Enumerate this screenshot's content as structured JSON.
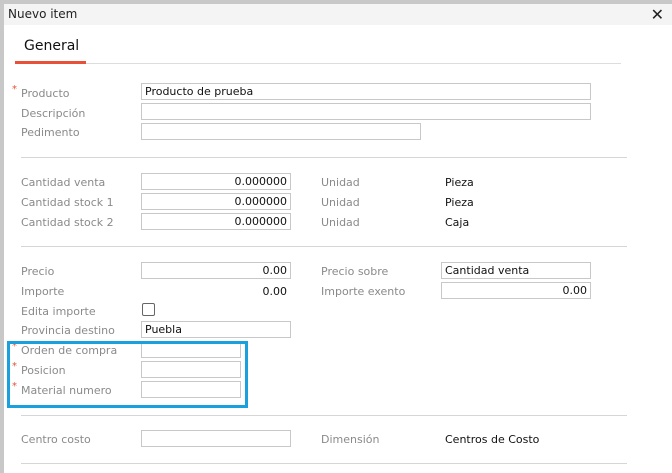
{
  "window": {
    "title": "Nuevo item",
    "close_icon": "close-icon"
  },
  "tabs": [
    {
      "label": "General",
      "active": true
    }
  ],
  "fields": {
    "producto": {
      "label": "Producto",
      "value": "Producto de prueba",
      "required": true
    },
    "descripcion": {
      "label": "Descripción",
      "value": ""
    },
    "pedimento": {
      "label": "Pedimento",
      "value": ""
    },
    "cantidad_venta": {
      "label": "Cantidad venta",
      "value": "0.000000",
      "unit_label": "Unidad",
      "unit": "Pieza"
    },
    "cantidad_stock1": {
      "label": "Cantidad stock 1",
      "value": "0.000000",
      "unit_label": "Unidad",
      "unit": "Pieza"
    },
    "cantidad_stock2": {
      "label": "Cantidad stock 2",
      "value": "0.000000",
      "unit_label": "Unidad",
      "unit": "Caja"
    },
    "precio": {
      "label": "Precio",
      "value": "0.00"
    },
    "precio_sobre": {
      "label": "Precio sobre",
      "value": "Cantidad venta"
    },
    "importe": {
      "label": "Importe",
      "value": "0.00"
    },
    "importe_exento": {
      "label": "Importe exento",
      "value": "0.00"
    },
    "edita_importe": {
      "label": "Edita importe",
      "checked": false
    },
    "provincia_destino": {
      "label": "Provincia destino",
      "value": "Puebla"
    },
    "orden_compra": {
      "label": "Orden de compra",
      "value": "",
      "required": true
    },
    "posicion": {
      "label": "Posicion",
      "value": "",
      "required": true
    },
    "material_numero": {
      "label": "Material numero",
      "value": "",
      "required": true
    },
    "centro_costo": {
      "label": "Centro costo",
      "value": ""
    },
    "dimension": {
      "label": "Dimensión",
      "value": "Centros de Costo"
    }
  },
  "required_mark": "*",
  "colors": {
    "accent": "#e8503a",
    "highlight": "#1aa0dc"
  }
}
